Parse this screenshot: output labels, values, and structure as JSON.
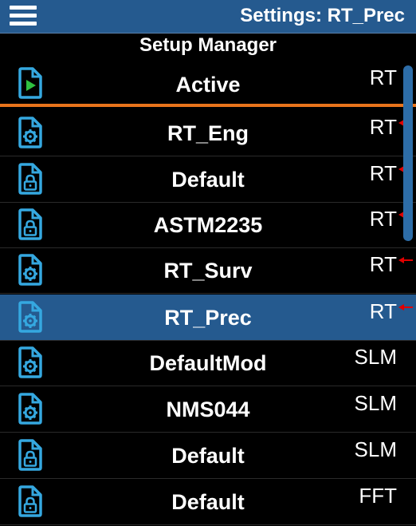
{
  "header": {
    "title": "Settings: RT_Prec"
  },
  "subtitle": "Setup Manager",
  "active": {
    "name": "Active",
    "type": "RT",
    "icon": "file-play-icon"
  },
  "items": [
    {
      "name": "RT_Eng",
      "type": "RT",
      "icon": "file-gear-icon",
      "marker": true
    },
    {
      "name": "Default",
      "type": "RT",
      "icon": "file-lock-icon",
      "marker": true
    },
    {
      "name": "ASTM2235",
      "type": "RT",
      "icon": "file-lock-icon",
      "marker": true
    },
    {
      "name": "RT_Surv",
      "type": "RT",
      "icon": "file-gear-icon",
      "marker": true
    },
    {
      "name": "RT_Prec",
      "type": "RT",
      "icon": "file-gear-icon",
      "marker": true,
      "selected": true
    },
    {
      "name": "DefaultMod",
      "type": "SLM",
      "icon": "file-gear-icon"
    },
    {
      "name": "NMS044",
      "type": "SLM",
      "icon": "file-gear-icon"
    },
    {
      "name": "Default",
      "type": "SLM",
      "icon": "file-lock-icon"
    },
    {
      "name": "Default",
      "type": "FFT",
      "icon": "file-lock-icon"
    }
  ],
  "colors": {
    "header_bg": "#255a8f",
    "accent_orange": "#e8741c",
    "marker_red": "#e00000",
    "icon_blue": "#35a8e0",
    "play_green": "#2fc040"
  }
}
